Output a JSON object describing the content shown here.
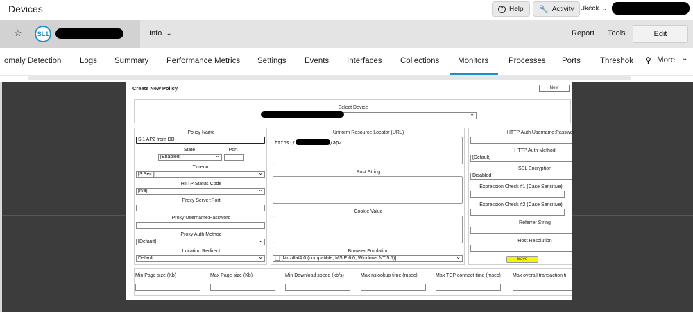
{
  "topbar": {
    "title": "Devices",
    "help_label": "Help",
    "activity_label": "Activity",
    "user_name": "Jkeck"
  },
  "device_bar": {
    "logo_text": "SL1",
    "info_label": "Info",
    "report_label": "Report",
    "tools_label": "Tools",
    "edit_label": "Edit"
  },
  "tabs": {
    "items": [
      "omaly Detection",
      "Logs",
      "Summary",
      "Performance Metrics",
      "Settings",
      "Events",
      "Interfaces",
      "Collections",
      "Monitors",
      "Processes",
      "Ports",
      "Threshold"
    ],
    "active": "Monitors",
    "more_label": "More"
  },
  "dialog": {
    "title": "Create New Policy",
    "new_button": "New",
    "select_device_label": "Select Device",
    "left": {
      "policy_name_label": "Policy Name",
      "policy_name_value": "Sl1 AP2 from DB",
      "state_label": "State",
      "state_value": "[Enabled]",
      "port_label": "Port",
      "port_value": "",
      "timeout_label": "Timeout",
      "timeout_value": "[3 Sec.]",
      "http_status_label": "HTTP Status Code",
      "http_status_value": "[n/a]",
      "proxy_server_label": "Proxy Server:Port",
      "proxy_server_value": "",
      "proxy_user_label": "Proxy Username:Password",
      "proxy_user_value": "",
      "proxy_auth_label": "Proxy Auth Method",
      "proxy_auth_value": "[Default]",
      "location_redirect_label": "Location Redirect",
      "location_redirect_value": "Default"
    },
    "middle": {
      "url_label": "Uniform Resource Locator (URL)",
      "url_prefix": "https:/",
      "url_suffix": "/ap2",
      "post_string_label": "Post String",
      "cookie_value_label": "Cookie Value",
      "browser_emulation_label": "Browser Emulation",
      "browser_emulation_value": "[_] [Mozilla/4.0 (compatible; MSIE 6.0; Windows NT 5.1)]"
    },
    "right": {
      "http_auth_user_label": "HTTP Auth Username:Passwor",
      "http_auth_user_value": "",
      "http_auth_method_label": "HTTP Auth Method",
      "http_auth_method_value": "[Default]",
      "ssl_label": "SSL Encryption",
      "ssl_value": "Disabled",
      "expr1_label": "Expression Check #1 (Case Sensitive)",
      "expr1_value": "",
      "expr2_label": "Expression Check #2 (Case Sensitive)",
      "expr2_value": "",
      "referrer_label": "Referrer String",
      "referrer_value": "",
      "host_res_label": "Host Resolution",
      "host_res_value": "",
      "save_label": "Save"
    },
    "bottom": {
      "min_page_label": "Min Page size (Kb)",
      "max_page_label": "Max Page size (Kb)",
      "min_download_label": "Min Download speed (kb/s)",
      "max_nslookup_label": "Max nslookup time (msec)",
      "max_tcp_label": "Max TCP connect time (msec)",
      "max_overall_label": "Max overall transaction ti"
    }
  },
  "colors": {
    "accent": "#1a8fc9",
    "save_button": "#f5f500",
    "dark_background": "#3c3c3c"
  }
}
